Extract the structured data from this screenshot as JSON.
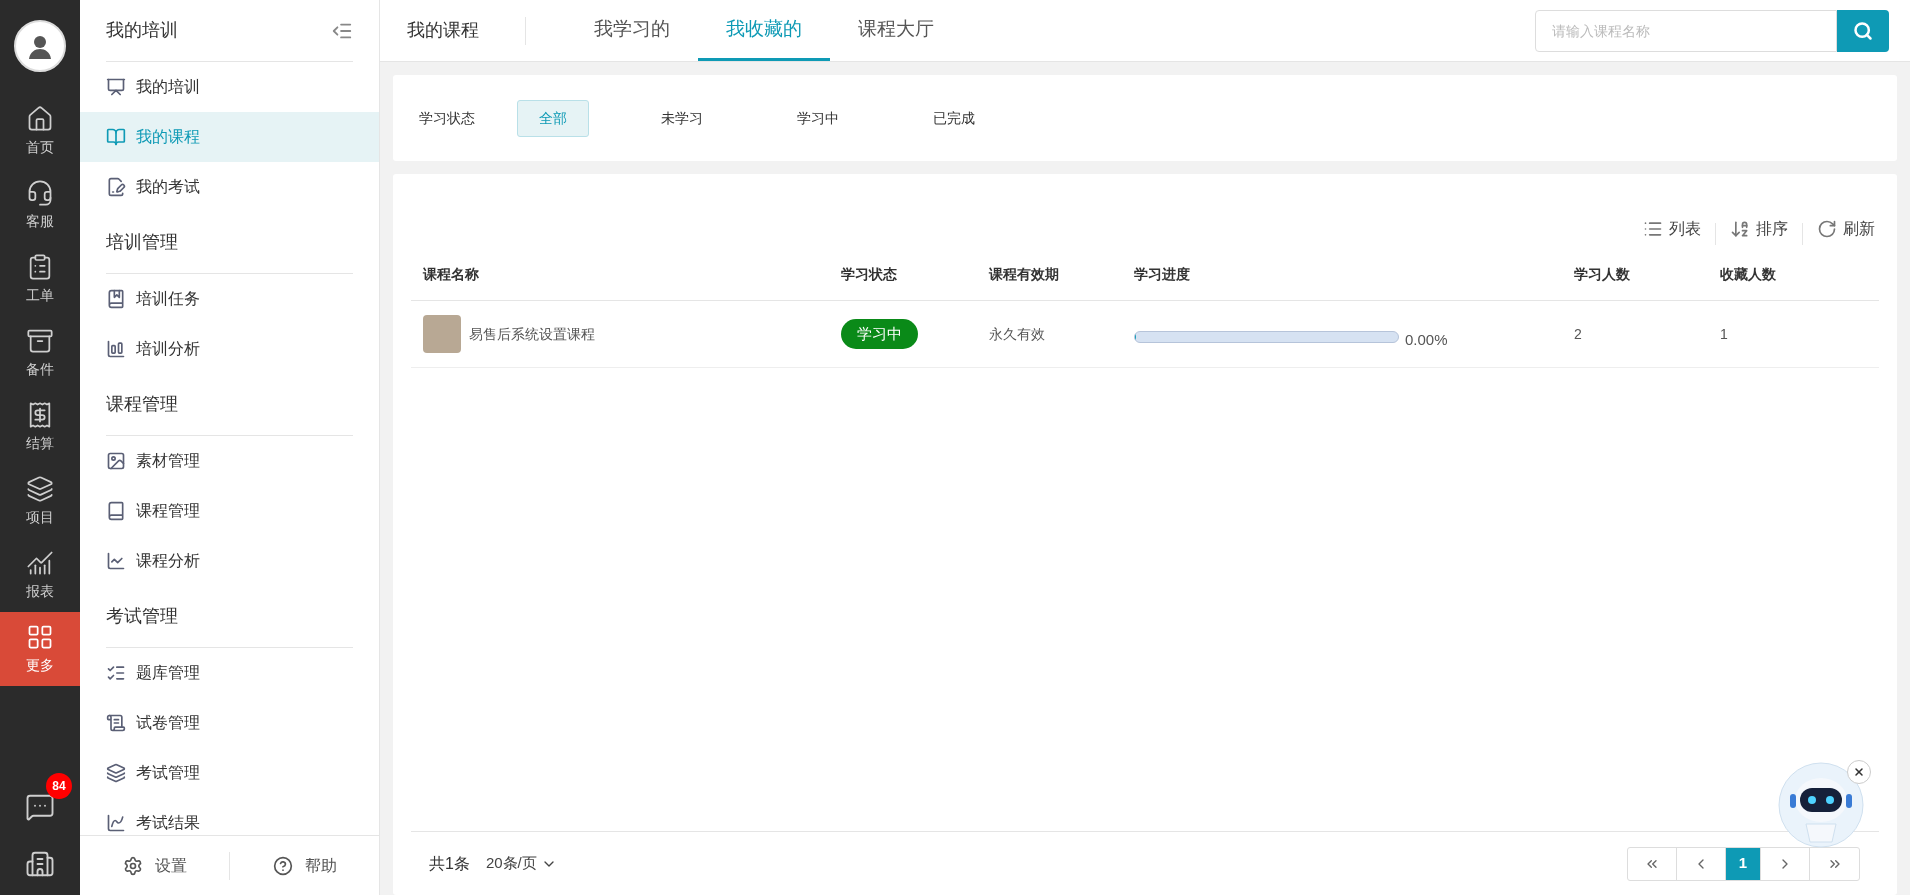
{
  "rail": {
    "items": [
      {
        "label": "首页",
        "selected": false
      },
      {
        "label": "客服",
        "selected": false
      },
      {
        "label": "工单",
        "selected": false
      },
      {
        "label": "备件",
        "selected": false
      },
      {
        "label": "结算",
        "selected": false
      },
      {
        "label": "项目",
        "selected": false
      },
      {
        "label": "报表",
        "selected": false
      },
      {
        "label": "更多",
        "selected": true
      }
    ],
    "chat_badge": "84"
  },
  "sidebar": {
    "title": "我的培训",
    "groups": [
      {
        "items": [
          {
            "label": "我的培训",
            "selected": false
          },
          {
            "label": "我的课程",
            "selected": true
          },
          {
            "label": "我的考试",
            "selected": false
          }
        ]
      },
      {
        "heading": "培训管理",
        "items": [
          {
            "label": "培训任务",
            "selected": false
          },
          {
            "label": "培训分析",
            "selected": false
          }
        ]
      },
      {
        "heading": "课程管理",
        "items": [
          {
            "label": "素材管理",
            "selected": false
          },
          {
            "label": "课程管理",
            "selected": false
          },
          {
            "label": "课程分析",
            "selected": false
          }
        ]
      },
      {
        "heading": "考试管理",
        "items": [
          {
            "label": "题库管理",
            "selected": false
          },
          {
            "label": "试卷管理",
            "selected": false
          },
          {
            "label": "考试管理",
            "selected": false
          },
          {
            "label": "考试结果",
            "selected": false
          }
        ]
      }
    ],
    "footer": [
      "设置",
      "帮助"
    ]
  },
  "header": {
    "title": "我的课程",
    "tabs": [
      {
        "label": "我学习的",
        "selected": false
      },
      {
        "label": "我收藏的",
        "selected": true
      },
      {
        "label": "课程大厅",
        "selected": false
      }
    ],
    "search": {
      "placeholder": "请输入课程名称"
    }
  },
  "filter": {
    "label": "学习状态",
    "options": [
      {
        "label": "全部",
        "selected": true
      },
      {
        "label": "未学习",
        "selected": false
      },
      {
        "label": "学习中",
        "selected": false
      },
      {
        "label": "已完成",
        "selected": false
      }
    ]
  },
  "toolbar": [
    "列表",
    "排序",
    "刷新"
  ],
  "table": {
    "columns": [
      "课程名称",
      "学习状态",
      "课程有效期",
      "学习进度",
      "学习人数",
      "收藏人数"
    ],
    "rows": [
      {
        "name": "易售后系统设置课程",
        "status": "学习中",
        "validity": "永久有效",
        "level": 0,
        "progress": "0.00%",
        "learners": "2",
        "favorites": "1"
      }
    ]
  },
  "pagination": {
    "total": "共1条",
    "page_size": "20条/页",
    "pages": [
      {
        "label": "1",
        "selected": true
      }
    ]
  }
}
